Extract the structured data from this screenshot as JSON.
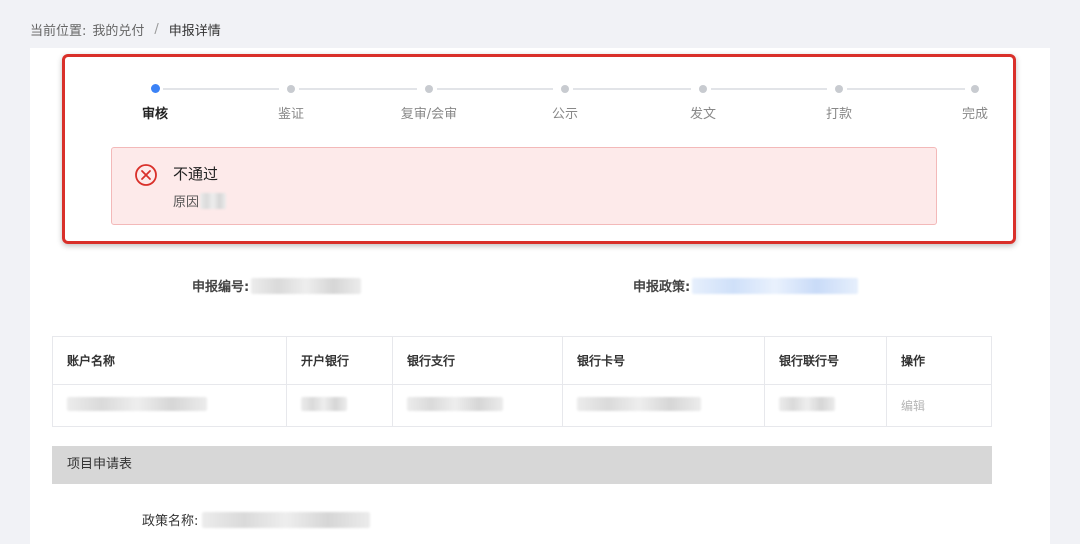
{
  "breadcrumb": {
    "prefix": "当前位置:",
    "parent": "我的兑付",
    "separator": "/",
    "current": "申报详情"
  },
  "steps": [
    {
      "label": "审核",
      "active": true
    },
    {
      "label": "鉴证",
      "active": false
    },
    {
      "label": "复审/会审",
      "active": false
    },
    {
      "label": "公示",
      "active": false
    },
    {
      "label": "发文",
      "active": false
    },
    {
      "label": "打款",
      "active": false
    },
    {
      "label": "完成",
      "active": false
    }
  ],
  "alert": {
    "title": "不通过",
    "reason_label": "原因"
  },
  "info": {
    "apply_no_label": "申报编号:",
    "policy_label": "申报政策:"
  },
  "bank_table": {
    "headers": [
      "账户名称",
      "开户银行",
      "银行支行",
      "银行卡号",
      "银行联行号",
      "操作"
    ],
    "row_action": "编辑"
  },
  "project": {
    "section_title": "项目申请表",
    "policy_name_label": "政策名称:"
  },
  "colors": {
    "accent": "#3b82f6",
    "alert_bg": "#fdeaea",
    "alert_border": "#f3b9b9",
    "error": "#d9302a",
    "highlight_border": "#d9302a"
  }
}
